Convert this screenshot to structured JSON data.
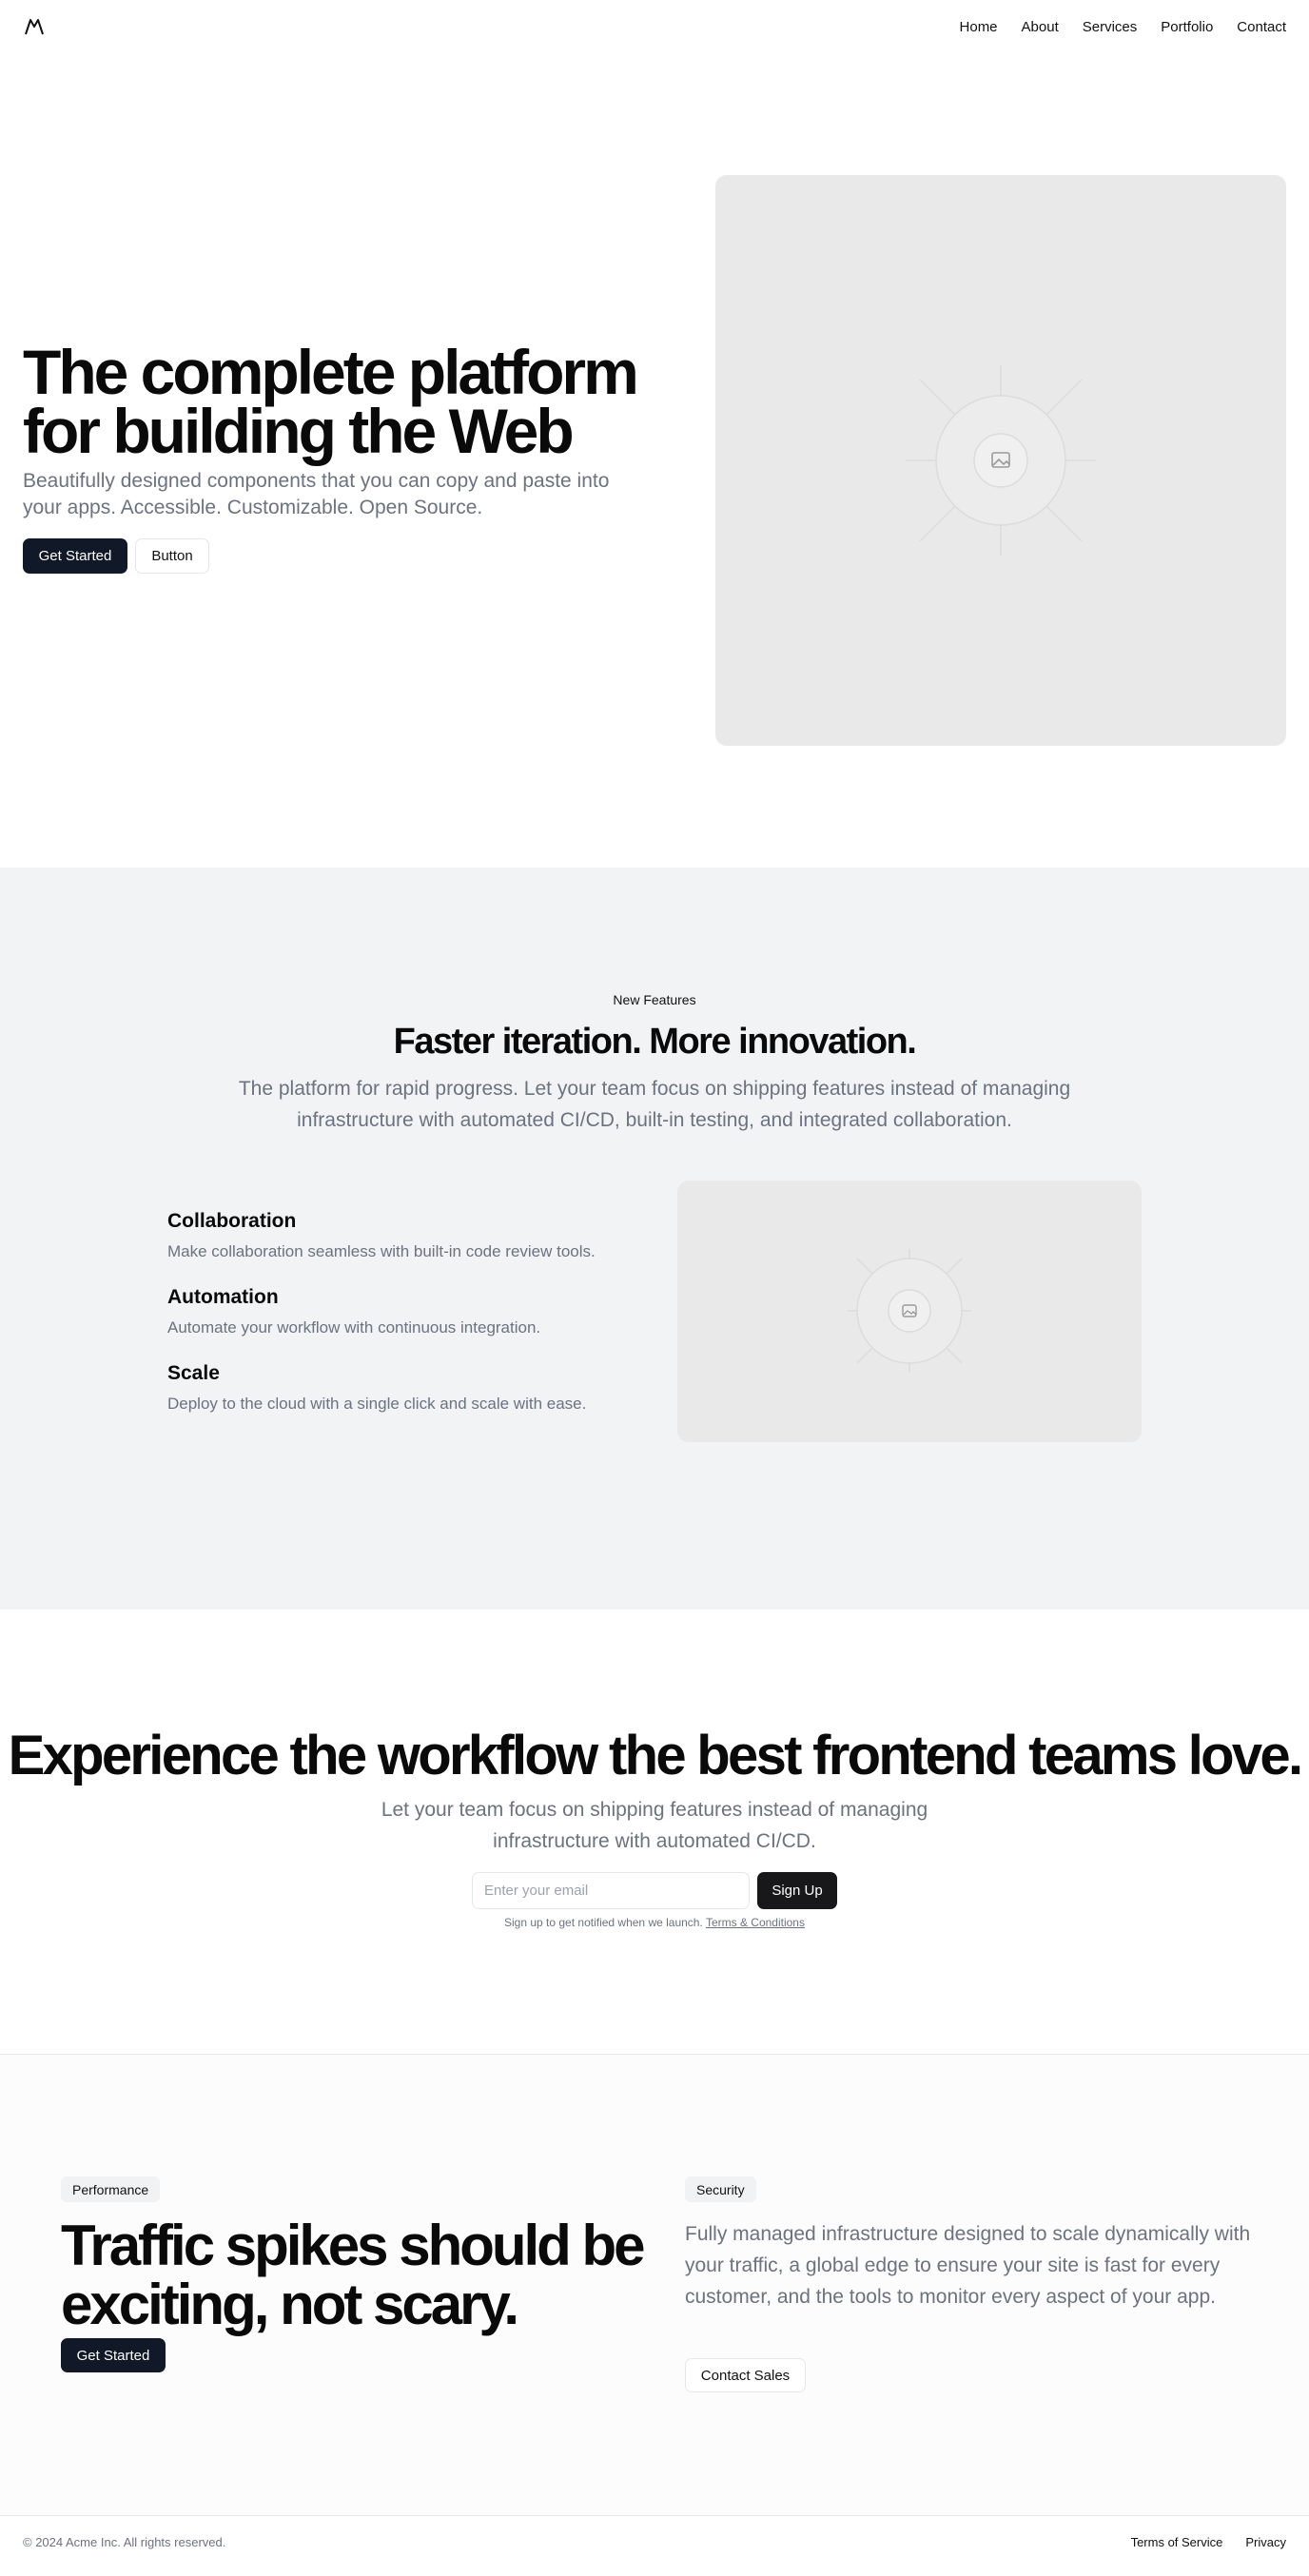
{
  "header": {
    "logo_icon": "mountain-icon",
    "nav": [
      {
        "label": "Home"
      },
      {
        "label": "About"
      },
      {
        "label": "Services"
      },
      {
        "label": "Portfolio"
      },
      {
        "label": "Contact"
      }
    ]
  },
  "hero": {
    "title": "The complete platform for building the Web",
    "subtitle": "Beautifully designed components that you can copy and paste into your apps. Accessible. Customizable. Open Source.",
    "primary_button": "Get Started",
    "secondary_button": "Button",
    "image_icon": "image-placeholder-icon"
  },
  "features": {
    "eyebrow": "New Features",
    "title": "Faster iteration. More innovation.",
    "subtitle": "The platform for rapid progress. Let your team focus on shipping features instead of managing infrastructure with automated CI/CD, built-in testing, and integrated collaboration.",
    "items": [
      {
        "title": "Collaboration",
        "description": "Make collaboration seamless with built-in code review tools."
      },
      {
        "title": "Automation",
        "description": "Automate your workflow with continuous integration."
      },
      {
        "title": "Scale",
        "description": "Deploy to the cloud with a single click and scale with ease."
      }
    ],
    "image_icon": "image-placeholder-icon"
  },
  "cta": {
    "title": "Experience the workflow the best frontend teams love.",
    "subtitle": "Let your team focus on shipping features instead of managing infrastructure with automated CI/CD.",
    "email_placeholder": "Enter your email",
    "button": "Sign Up",
    "note": "Sign up to get notified when we launch.",
    "terms_link": "Terms & Conditions"
  },
  "performance": {
    "tag": "Performance",
    "title": "Traffic spikes should be exciting, not scary.",
    "button": "Get Started"
  },
  "security": {
    "tag": "Security",
    "text": "Fully managed infrastructure designed to scale dynamically with your traffic, a global edge to ensure your site is fast for every customer, and the tools to monitor every aspect of your app.",
    "button": "Contact Sales"
  },
  "footer": {
    "copyright": "© 2024 Acme Inc. All rights reserved.",
    "links": [
      {
        "label": "Terms of Service"
      },
      {
        "label": "Privacy"
      }
    ]
  },
  "colors": {
    "primary_button": "#111827",
    "muted_text": "#6b7280",
    "section_bg": "#f2f3f5",
    "placeholder_bg": "#e9e9e9"
  }
}
